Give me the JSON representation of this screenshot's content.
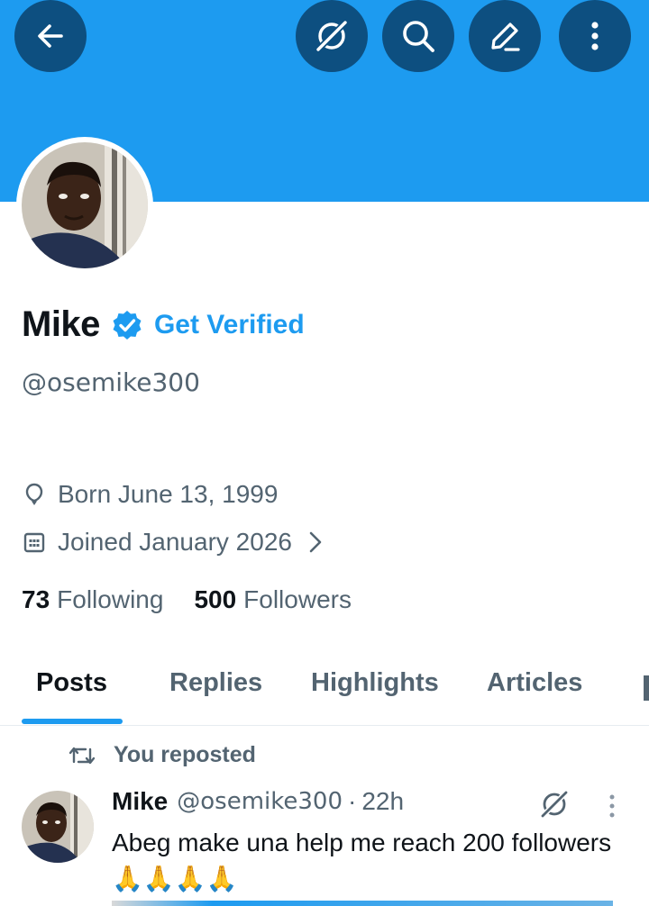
{
  "header": {
    "back_icon": "arrow-left-icon",
    "grok_icon": "grok-icon",
    "search_icon": "search-icon",
    "edit_icon": "pencil-icon",
    "more_icon": "more-vertical-icon",
    "banner_color": "#1d9bf0",
    "button_color": "#0d4f80"
  },
  "profile": {
    "name": "Mike",
    "verified_icon": "verified-badge-icon",
    "get_verified_label": "Get Verified",
    "handle": "@osemike300",
    "birthday": "Born June 13, 1999",
    "joined": "Joined January 2026",
    "following_count": "73",
    "following_label": "Following",
    "followers_count": "500",
    "followers_label": "Followers"
  },
  "tabs": [
    {
      "label": "Posts",
      "active": true
    },
    {
      "label": "Replies",
      "active": false
    },
    {
      "label": "Highlights",
      "active": false
    },
    {
      "label": "Articles",
      "active": false
    }
  ],
  "feed": {
    "repost_label": "You reposted",
    "post": {
      "author": "Mike",
      "handle": "@osemike300",
      "separator": "·",
      "time": "22h",
      "text": "Abeg make una help me reach 200 followers",
      "emoji": "🙏🙏🙏🙏"
    }
  },
  "colors": {
    "accent": "#1d9bf0",
    "text_primary": "#0f1419",
    "text_secondary": "#536471"
  }
}
